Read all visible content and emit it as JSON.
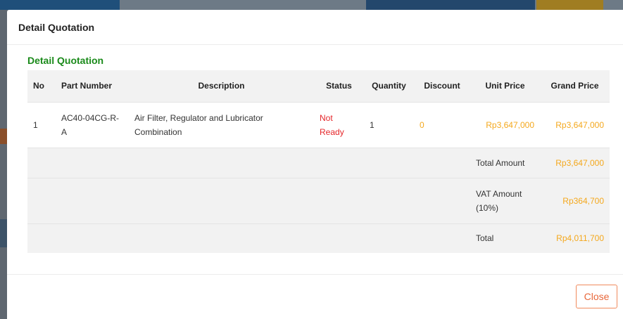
{
  "modal": {
    "title": "Detail Quotation",
    "section_title": "Detail Quotation",
    "close_label": "Close"
  },
  "table": {
    "headers": {
      "no": "No",
      "part_number": "Part Number",
      "description": "Description",
      "status": "Status",
      "quantity": "Quantity",
      "discount": "Discount",
      "unit_price": "Unit Price",
      "grand_price": "Grand Price"
    },
    "rows": [
      {
        "no": "1",
        "part_number": "AC40-04CG-R-A",
        "description": "Air Filter, Regulator and Lubricator Combination",
        "status": "Not Ready",
        "quantity": "1",
        "discount": "0",
        "unit_price": "Rp3,647,000",
        "grand_price": "Rp3,647,000"
      }
    ],
    "summary": {
      "total_amount_label": "Total Amount",
      "total_amount_value": "Rp3,647,000",
      "vat_label": "VAT Amount (10%)",
      "vat_value": "Rp364,700",
      "total_label": "Total",
      "total_value": "Rp4,011,700"
    }
  },
  "colors": {
    "section_title": "#1a8a1a",
    "status_not_ready": "#e5262a",
    "price": "#f4a81d",
    "close_button": "#e8673a"
  }
}
